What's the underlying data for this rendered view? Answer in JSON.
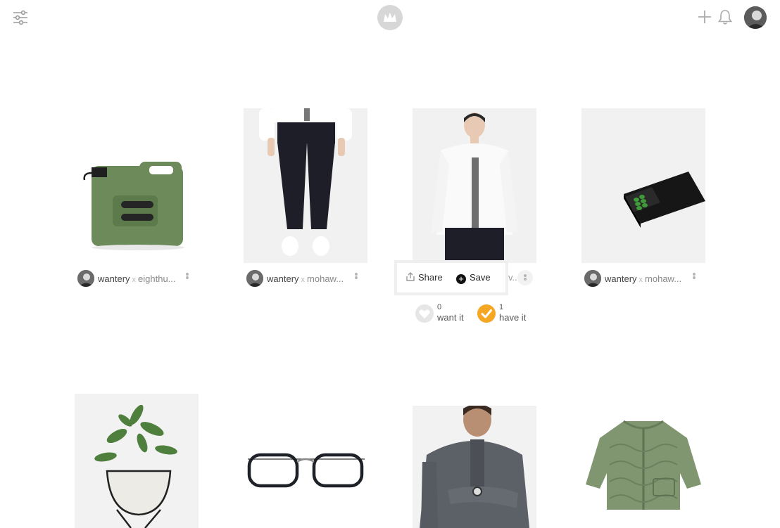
{
  "header": {
    "filters_icon": "sliders-icon",
    "logo_icon": "crown-logo-icon",
    "plus_icon": "plus-icon",
    "bell_icon": "bell-icon"
  },
  "products": [
    {
      "user": "wantery",
      "separator": "x",
      "collection": "eighthu...",
      "image": "green jerry can"
    },
    {
      "user": "wantery",
      "separator": "x",
      "collection": "mohaw...",
      "image": "black trousers"
    },
    {
      "user": "",
      "separator": "",
      "collection": "",
      "image": "white shirt with grey placket"
    },
    {
      "user": "wantery",
      "separator": "x",
      "collection": "mohaw...",
      "image": "black matchbox"
    },
    {
      "image": "potted plant in bowl planter"
    },
    {
      "image": "black eyeglasses"
    },
    {
      "image": "grey cable knit sweater"
    },
    {
      "image": "olive quilted jacket"
    }
  ],
  "hover_actions": {
    "share_label": "Share",
    "save_label": "Save",
    "save_symbol": "+",
    "truncated_text": "v...",
    "want_count": "0",
    "want_label": "want it",
    "have_count": "1",
    "have_label": "have it"
  },
  "colors": {
    "have_accent": "#f5a623",
    "jerry_can": "#6d8a5a",
    "jacket": "#7f9670"
  }
}
